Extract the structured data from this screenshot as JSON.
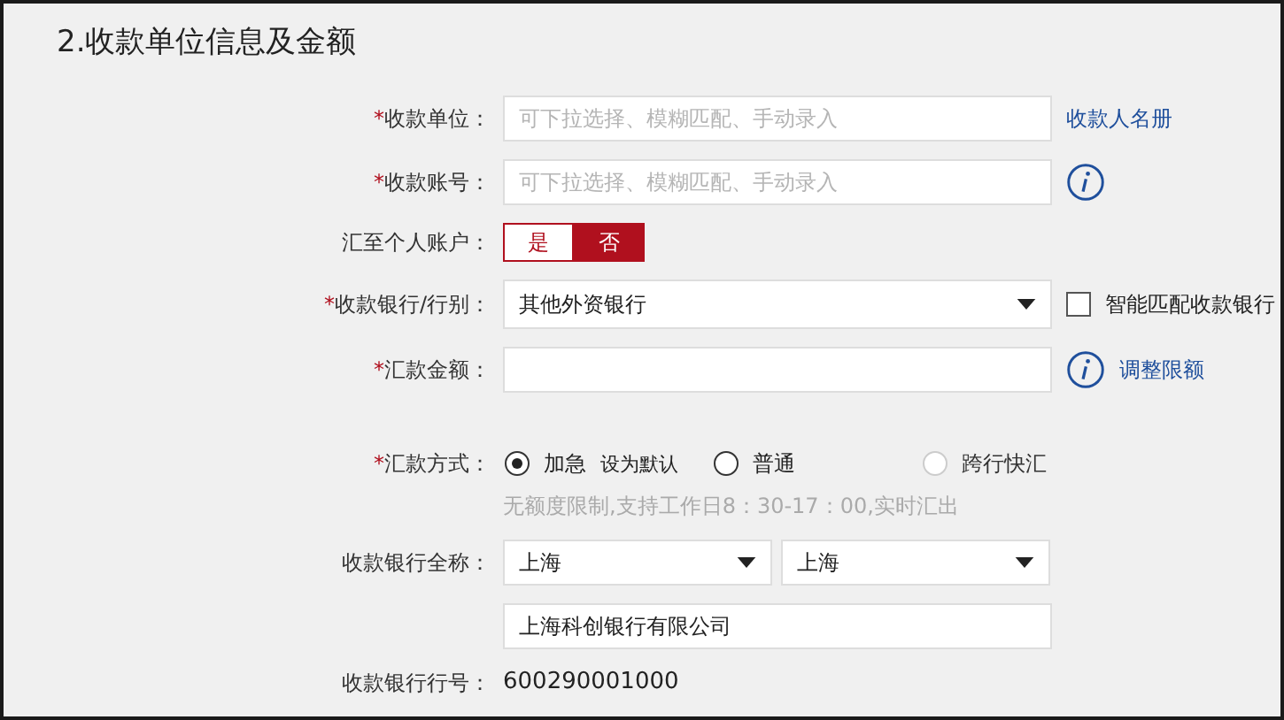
{
  "section_title": "2.收款单位信息及金额",
  "rows": [
    {
      "kind": "input",
      "mark": "*",
      "label": "收款单位：",
      "placeholder": "可下拉选择、模糊匹配、手动录入",
      "extra": {
        "kind": "link",
        "text": "收款人名册"
      }
    },
    {
      "kind": "input",
      "mark": "*",
      "label": "收款账号：",
      "placeholder": "可下拉选择、模糊匹配、手动录入",
      "extra": {
        "kind": "info"
      }
    },
    {
      "kind": "toggle",
      "label": "汇至个人账户：",
      "options": [
        {
          "label": "是",
          "selected": false
        },
        {
          "label": "否",
          "selected": true
        }
      ]
    },
    {
      "kind": "select",
      "mark": "*",
      "label": "收款银行/行别：",
      "value": "其他外资银行",
      "extra": {
        "kind": "checkbox",
        "text": "智能匹配收款银行",
        "checked": false
      }
    },
    {
      "kind": "input",
      "mark": "*",
      "label": "汇款金额：",
      "extra": {
        "kind": "info_link",
        "text": "调整限额"
      }
    },
    {
      "kind": "radio",
      "mark": "*",
      "label": "汇款方式：",
      "options": [
        {
          "label": "加急",
          "selected": true,
          "disabled": false,
          "note": "设为默认"
        },
        {
          "label": "普通",
          "selected": false,
          "disabled": false
        },
        {
          "label": "跨行快汇",
          "selected": false,
          "disabled": true
        }
      ],
      "hint": "无额度限制,支持工作日8：30-17：00,实时汇出"
    },
    {
      "kind": "selects",
      "label": "收款银行全称：",
      "values": [
        "上海",
        "上海"
      ]
    },
    {
      "kind": "input",
      "value": "上海科创银行有限公司"
    },
    {
      "kind": "text",
      "label": "收款银行行号：",
      "value": "600290001000"
    }
  ]
}
